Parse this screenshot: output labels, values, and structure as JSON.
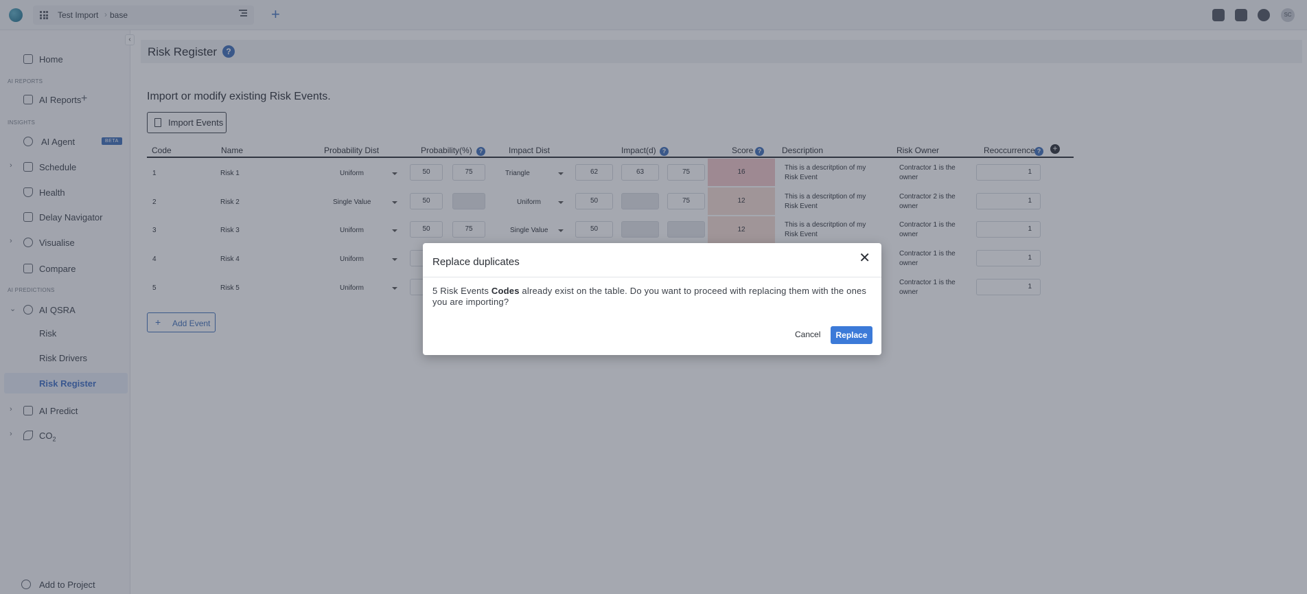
{
  "topbar": {
    "breadcrumb": [
      "Test Import",
      "base"
    ],
    "avatar_initials": "SC"
  },
  "sidebar": {
    "home": "Home",
    "section_ai_reports": "AI REPORTS",
    "ai_reports": "AI Reports",
    "section_insights": "INSIGHTS",
    "ai_agent": "AI Agent",
    "beta_badge": "BETA",
    "schedule": "Schedule",
    "health": "Health",
    "delay_navigator": "Delay Navigator",
    "visualise": "Visualise",
    "compare": "Compare",
    "section_ai_predictions": "AI PREDICTIONS",
    "ai_qsra": "AI QSRA",
    "risk": "Risk",
    "risk_drivers": "Risk Drivers",
    "risk_register": "Risk Register",
    "ai_predict": "AI Predict",
    "co2": "CO",
    "co2_sub": "2",
    "add_to_project": "Add to Project"
  },
  "page": {
    "title": "Risk Register",
    "subtitle": "Import or modify existing Risk Events.",
    "import_button": "Import Events",
    "add_event_button": "Add Event"
  },
  "table": {
    "headers": {
      "code": "Code",
      "name": "Name",
      "probability_dist": "Probability Dist",
      "probability": "Probability(%)",
      "impact_dist": "Impact Dist",
      "impact": "Impact(d)",
      "score": "Score",
      "description": "Description",
      "risk_owner": "Risk Owner",
      "reoccurrence": "Reoccurrence"
    },
    "rows": [
      {
        "code": "1",
        "name": "Risk 1",
        "prob_dist": "Uniform",
        "p1": "50",
        "p2": "75",
        "impact_dist": "Triangle",
        "i1": "62",
        "i2": "63",
        "i3": "75",
        "score": "16",
        "description": "This is a descritption of my Risk Event",
        "owner": "Contractor 1 is the owner",
        "reoccurrence": "1"
      },
      {
        "code": "2",
        "name": "Risk 2",
        "prob_dist": "Single Value",
        "p1": "50",
        "p2": "",
        "impact_dist": "Uniform",
        "i1": "50",
        "i2": "",
        "i3": "75",
        "score": "12",
        "description": "This is a descritption of my Risk Event",
        "owner": "Contractor 2 is the owner",
        "reoccurrence": "1"
      },
      {
        "code": "3",
        "name": "Risk 3",
        "prob_dist": "Uniform",
        "p1": "50",
        "p2": "75",
        "impact_dist": "Single Value",
        "i1": "50",
        "i2": "",
        "i3": "",
        "score": "12",
        "description": "This is a descritption of my Risk Event",
        "owner": "Contractor 1 is the owner",
        "reoccurrence": "1"
      },
      {
        "code": "4",
        "name": "Risk 4",
        "prob_dist": "Uniform",
        "owner": "Contractor 1 is the owner",
        "reoccurrence": "1"
      },
      {
        "code": "5",
        "name": "Risk 5",
        "prob_dist": "Uniform",
        "owner": "Contractor 1 is the owner",
        "reoccurrence": "1"
      }
    ]
  },
  "modal": {
    "title": "Replace duplicates",
    "body_prefix": "5 Risk Events ",
    "body_bold": "Codes",
    "body_suffix": " already exist on the table. Do you want to proceed with replacing them with the ones you are importing?",
    "cancel": "Cancel",
    "replace": "Replace"
  },
  "colors": {
    "accent": "#3c6db8",
    "replace_button": "#3c7ad8",
    "score_high": "#f3c6c9",
    "score_medium": "#f6dcd3"
  }
}
